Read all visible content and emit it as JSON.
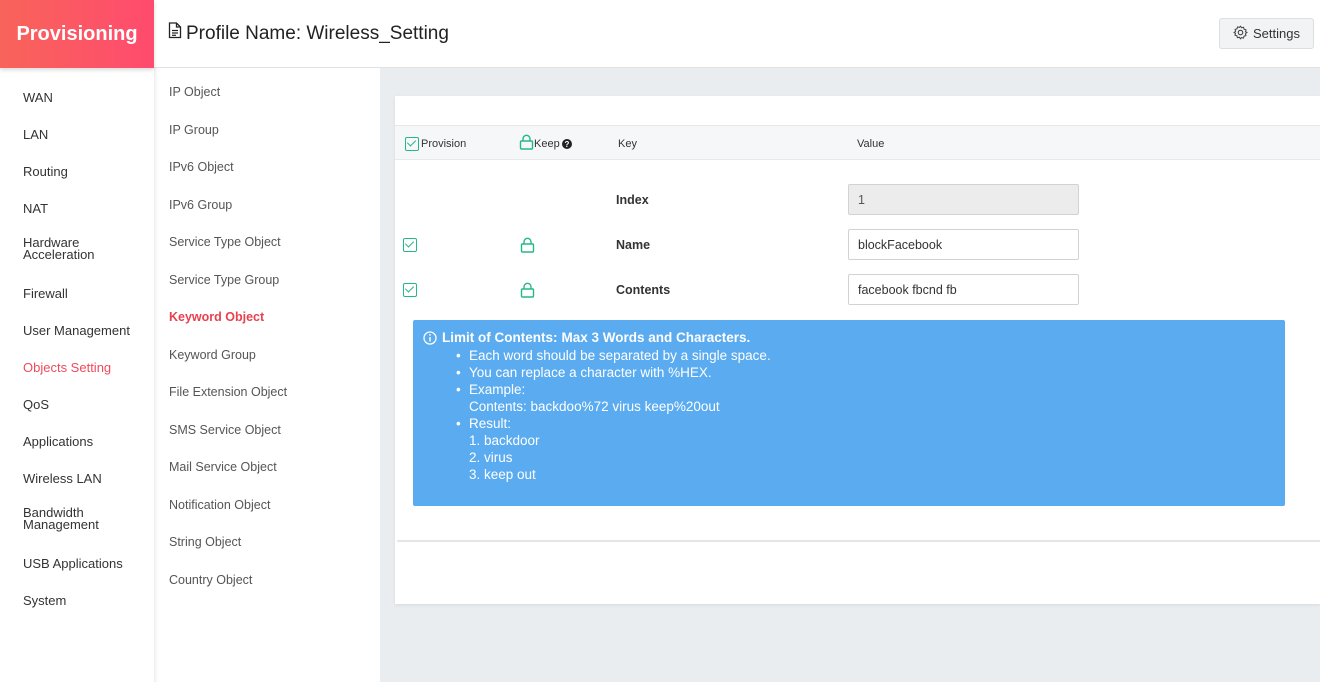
{
  "brand": "Provisioning",
  "header": {
    "title": "Profile Name: Wireless_Setting",
    "settings_label": "Settings"
  },
  "sidebar": {
    "items": [
      {
        "label": "WAN"
      },
      {
        "label": "LAN"
      },
      {
        "label": "Routing"
      },
      {
        "label": "NAT"
      },
      {
        "label": "Hardware Acceleration"
      },
      {
        "label": "Firewall"
      },
      {
        "label": "User Management"
      },
      {
        "label": "Objects Setting"
      },
      {
        "label": "QoS"
      },
      {
        "label": "Applications"
      },
      {
        "label": "Wireless LAN"
      },
      {
        "label": "Bandwidth Management"
      },
      {
        "label": "USB Applications"
      },
      {
        "label": "System"
      }
    ],
    "active": "Objects Setting"
  },
  "subnav": {
    "items": [
      {
        "label": "IP Object"
      },
      {
        "label": "IP Group"
      },
      {
        "label": "IPv6 Object"
      },
      {
        "label": "IPv6 Group"
      },
      {
        "label": "Service Type Object"
      },
      {
        "label": "Service Type Group"
      },
      {
        "label": "Keyword Object"
      },
      {
        "label": "Keyword Group"
      },
      {
        "label": "File Extension Object"
      },
      {
        "label": "SMS Service Object"
      },
      {
        "label": "Mail Service Object"
      },
      {
        "label": "Notification Object"
      },
      {
        "label": "String Object"
      },
      {
        "label": "Country Object"
      }
    ],
    "active": "Keyword Object"
  },
  "table": {
    "headers": {
      "provision": "Provision",
      "keep": "Keep",
      "key": "Key",
      "value": "Value"
    },
    "rows": [
      {
        "key": "Index",
        "value": "1",
        "disabled": true
      },
      {
        "key": "Name",
        "value": "blockFacebook",
        "provision": true,
        "keep": true
      },
      {
        "key": "Contents",
        "value": "facebook fbcnd fb",
        "provision": true,
        "keep": true
      }
    ]
  },
  "info": {
    "title_bold": "Limit of Contents:",
    "title_rest": "Max 3 Words and Characters.",
    "bullets": [
      "Each word should be separated by a single space.",
      "You can replace a character with %HEX.",
      "Example:",
      "Result:"
    ],
    "example_line": "Contents: backdoo%72 virus keep%20out",
    "results": [
      "1. backdoor",
      "2. virus",
      "3. keep out"
    ]
  },
  "colors": {
    "brand_gradient_start": "#f8645a",
    "brand_gradient_end": "#ff4b6e",
    "active_nav": "#f04a5d",
    "check_green": "#25b887",
    "info_blue": "#5aabf0"
  }
}
